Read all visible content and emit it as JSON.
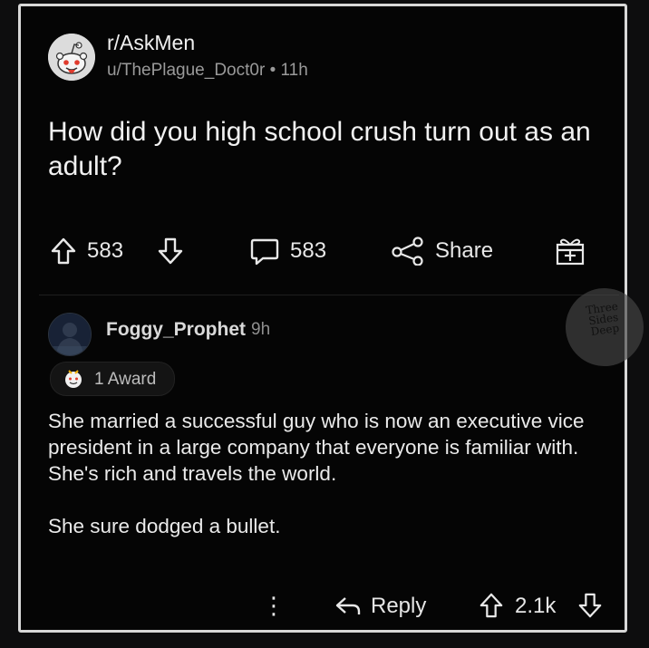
{
  "post": {
    "subreddit": "r/AskMen",
    "author": "u/ThePlague_Doct0r",
    "separator": "•",
    "age": "11h",
    "title": "How did you high school crush turn out as an adult?",
    "upvotes": "583",
    "comments": "583",
    "share_label": "Share"
  },
  "comment": {
    "username": "Foggy_Prophet",
    "age": "9h",
    "award_label": "1 Award",
    "paragraph_1": "She married a successful guy who is now an executive vice president in a large company that everyone is familiar with. She's rich and travels the world.",
    "paragraph_2": "She sure dodged a bullet.",
    "more_label": "⋮",
    "reply_label": "Reply",
    "score": "2.1k"
  },
  "watermark": {
    "line_1": "Three",
    "line_2": "Sides",
    "line_3": "Deep"
  },
  "icons": {
    "subreddit_avatar": "reddit-snoo-icon",
    "upvote": "arrow-up-icon",
    "downvote": "arrow-down-icon",
    "comments": "speech-bubble-icon",
    "share": "share-nodes-icon",
    "award": "gift-icon",
    "reply": "reply-arrow-icon"
  },
  "colors": {
    "background": "#050505",
    "frame_border": "#d8d8d8",
    "text_primary": "#f1f1f1",
    "text_secondary": "#9a9a9a"
  }
}
